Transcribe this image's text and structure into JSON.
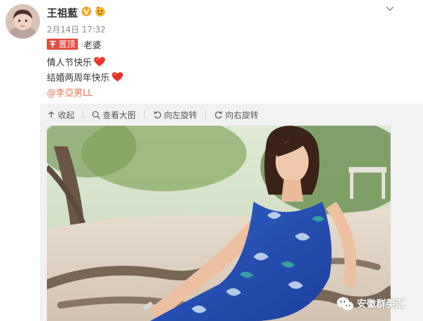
{
  "post": {
    "author": "王祖藍",
    "timestamp": "2月14日 17:32",
    "pin_label": "置顶",
    "lines": [
      "老婆",
      "情人节快乐",
      "结婚两周年快乐"
    ],
    "mention": "@李亞男LL"
  },
  "toolbar": {
    "collapse": "收起",
    "view_large": "查看大图",
    "rotate_left": "向左旋转",
    "rotate_right": "向右旋转"
  },
  "watermark": "安徽群英汇",
  "colors": {
    "accent": "#eb7350",
    "pin": "#e74c3c",
    "heart": "#e8322b",
    "verified": "#f5a623"
  },
  "icons": {
    "verified": "verified-icon",
    "vip": "vip-icon",
    "heart": "heart-icon",
    "collapse": "collapse-icon",
    "view_large": "magnify-icon",
    "rotate_left": "rotate-left-icon",
    "rotate_right": "rotate-right-icon",
    "more": "chevron-down-icon",
    "watermark": "wechat-icon"
  }
}
